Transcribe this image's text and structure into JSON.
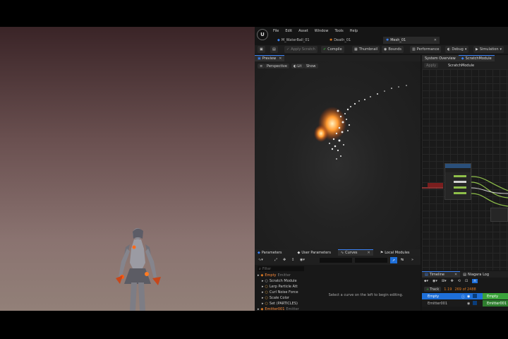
{
  "editor": {
    "menu": [
      "File",
      "Edit",
      "Asset",
      "Window",
      "Tools",
      "Help"
    ],
    "tabs": [
      {
        "label": "M_WaterBall_01"
      },
      {
        "label": "Death_01"
      },
      {
        "label": "Mesh_01"
      }
    ],
    "toolbar": {
      "apply_scratch": "Apply Scratch",
      "compile": "Compile",
      "thumbnail": "Thumbnail",
      "bounds": "Bounds",
      "performance": "Performance",
      "debug": "Debug",
      "simulation": "Simulation"
    },
    "preview": {
      "tab": "Preview",
      "perspective": "Perspective",
      "lit": "Lit",
      "show": "Show"
    },
    "system_overview": {
      "tab1": "System Overview",
      "tab2": "ScratchModule",
      "apply": "Apply",
      "scratch_title": "ScratchModule"
    },
    "bottom_tabs": {
      "parameters": "Parameters",
      "user_parameters": "User Parameters",
      "curves": "Curves",
      "local_modules": "Local Modules"
    },
    "tree": {
      "filter_placeholder": "Filter",
      "items": [
        {
          "label": "Empty",
          "suffix": "Emitter",
          "accent": "#e07a20",
          "indent": 0
        },
        {
          "label": "Scratch Module",
          "suffix": "",
          "accent": "#cccccc",
          "indent": 1
        },
        {
          "label": "Lerp Particle Att",
          "suffix": "",
          "accent": "#e0a040",
          "indent": 1
        },
        {
          "label": "Curl Noise Force",
          "suffix": "",
          "accent": "#e0a040",
          "indent": 1
        },
        {
          "label": "Scale Color",
          "suffix": "",
          "accent": "#e0a040",
          "indent": 1
        },
        {
          "label": "Set (PARTICLES)",
          "suffix": "",
          "accent": "#e0a040",
          "indent": 1
        },
        {
          "label": "Emitter001",
          "suffix": "Emitter",
          "accent": "#e07a20",
          "indent": 0
        }
      ]
    },
    "curves_hint": "Select a curve on the left to begin editing.",
    "timeline": {
      "tab": "Timeline",
      "log_tab": "Niagara Log",
      "track": "Track",
      "frame": "1.19",
      "range": "269 of 2488",
      "rows": [
        "Empty",
        "Emitter001"
      ]
    },
    "graph_node": {
      "rows": [
        "",
        "",
        "",
        ""
      ]
    },
    "colors": {
      "accent_blue": "#1e6fd9",
      "orange": "#e07a20",
      "green": "#3aa33a"
    }
  }
}
